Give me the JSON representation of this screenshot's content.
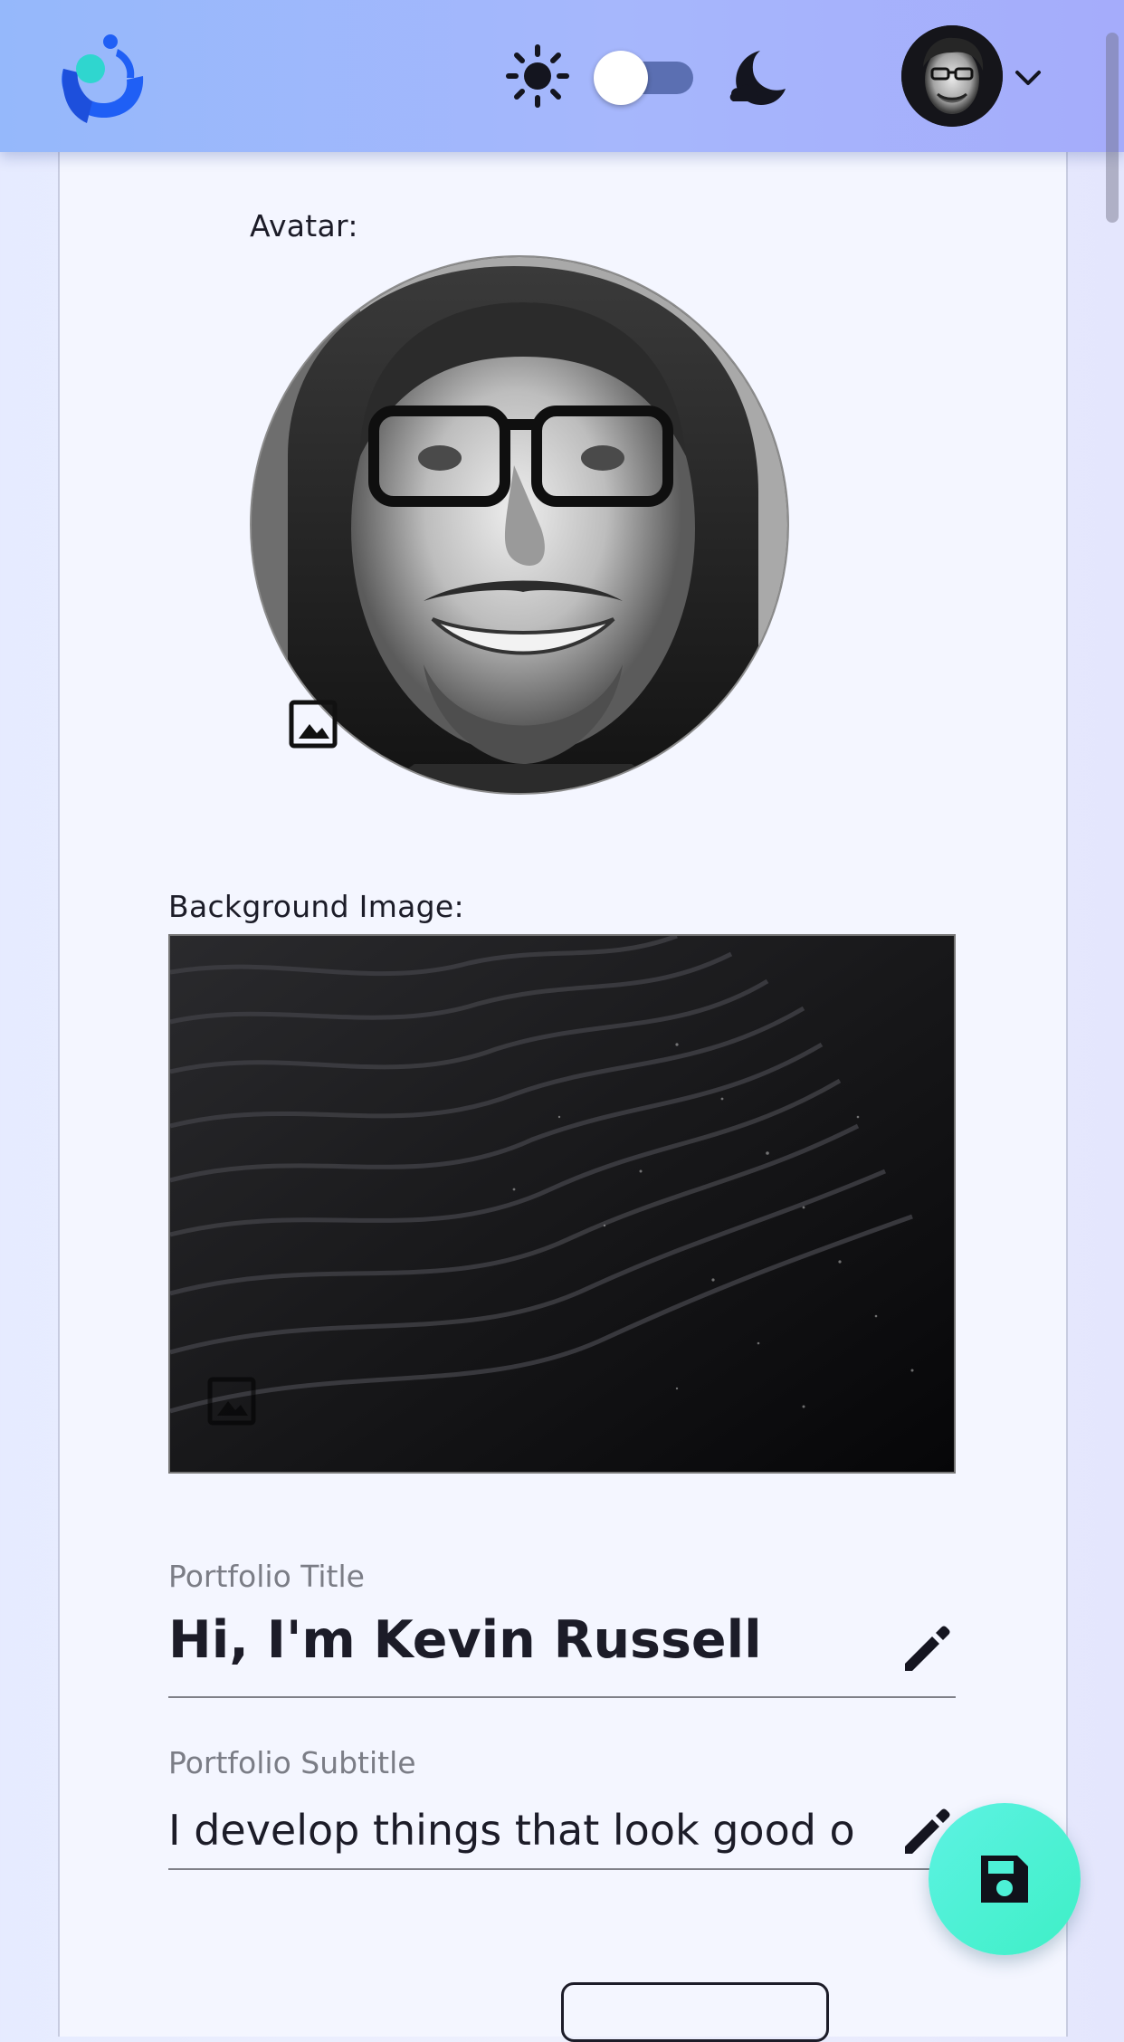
{
  "header": {
    "logo_icon": "brand-logo-icon",
    "theme": {
      "light_icon": "sun-icon",
      "dark_icon": "moon-icon",
      "dark_mode_on": false
    },
    "user_menu_icon": "chevron-down-icon"
  },
  "profile_editor": {
    "avatar_label": "Avatar:",
    "avatar_change_icon": "image-icon",
    "background_label": "Background Image:",
    "background_change_icon": "image-icon",
    "title_field": {
      "caption": "Portfolio Title",
      "value": "Hi, I'm Kevin Russell",
      "edit_icon": "pencil-icon"
    },
    "subtitle_field": {
      "caption": "Portfolio Subtitle",
      "value": "I develop things that look good on",
      "edit_icon": "pencil-icon"
    }
  },
  "fab": {
    "save_icon": "floppy-disk-icon"
  },
  "colors": {
    "header_gradient_start": "#95b8fb",
    "header_gradient_end": "#a5acfb",
    "card_background": "#f4f6ff",
    "fab_accent": "#4df0d6",
    "text_primary": "#1c1c28",
    "caption_text": "#7b7d86"
  }
}
